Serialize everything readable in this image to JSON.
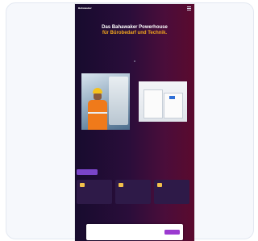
{
  "topbar": {
    "brand": "Bahawaker"
  },
  "hero": {
    "title_line1": "Das Bahawaker Powerhouse",
    "title_line2": "für Bürobedarf und Technik."
  },
  "colors": {
    "accent": "#f2a61d",
    "background_left": "#170c2e",
    "background_right": "#5a0a2e",
    "button": "#7a45c8",
    "cookie_button": "#9b3ad0"
  }
}
